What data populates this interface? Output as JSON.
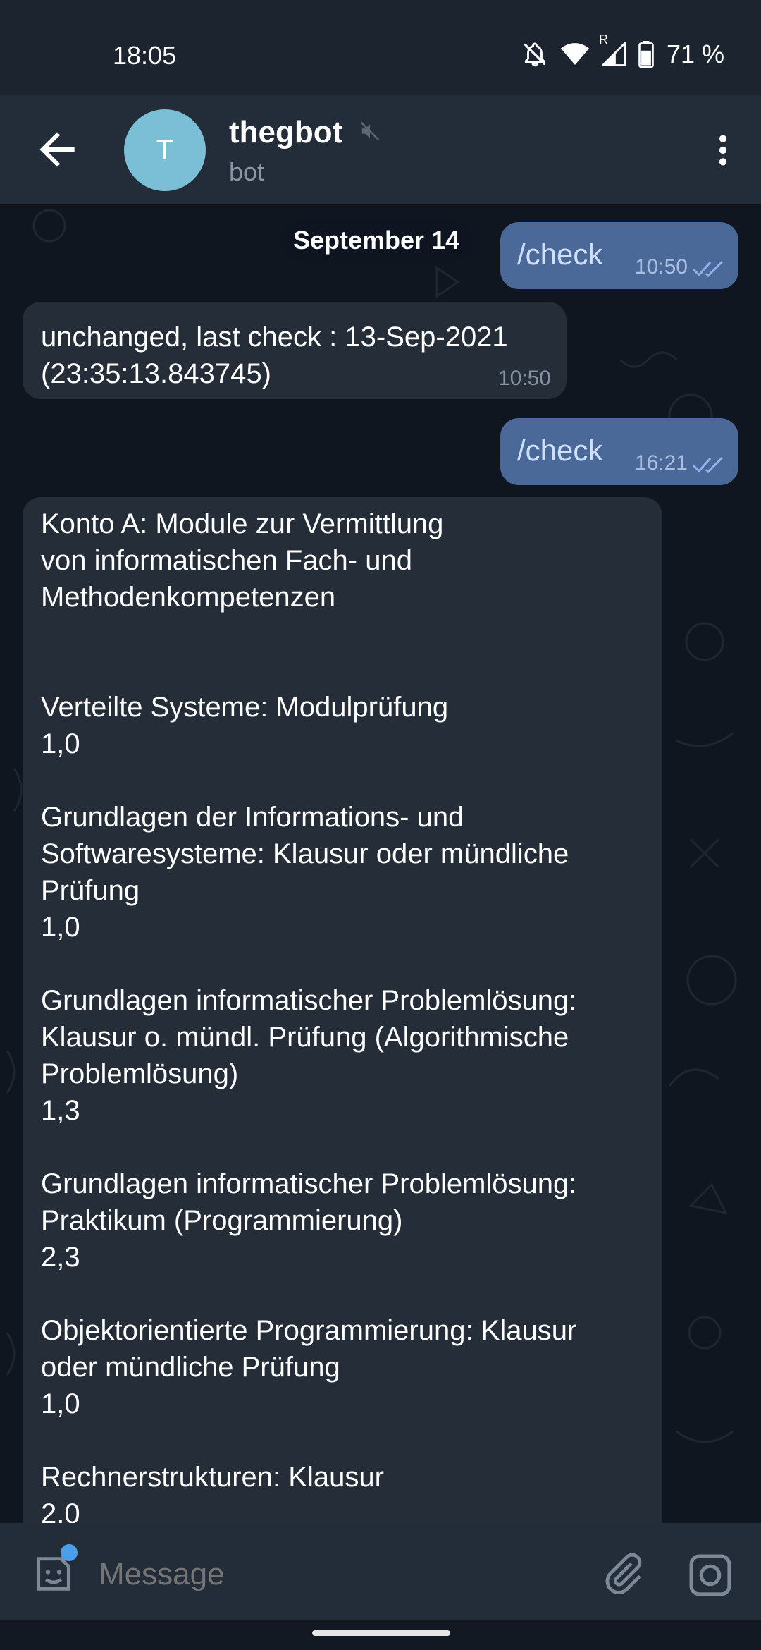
{
  "status_bar": {
    "time": "18:05",
    "battery_label": "71 %",
    "network_indicator": "R"
  },
  "header": {
    "avatar_letter": "T",
    "title": "thegbot",
    "subtitle": "bot"
  },
  "chat": {
    "date_chip": "September 14",
    "messages": [
      {
        "direction": "out",
        "text": "/check",
        "time": "10:50",
        "status": "read"
      },
      {
        "direction": "in",
        "text": "unchanged, last check : 13-Sep-2021\n(23:35:13.843745)",
        "time": "10:50"
      },
      {
        "direction": "out",
        "text": "/check",
        "time": "16:21",
        "status": "read"
      },
      {
        "direction": "in",
        "lines": [
          "Konto A: Module zur Vermittlung",
          "von informatischen Fach- und",
          "Methodenkompetenzen",
          "",
          "",
          "Verteilte Systeme: Modulprüfung",
          "1,0",
          "",
          "Grundlagen der Informations- und",
          "Softwaresysteme:  Klausur oder mündliche",
          "Prüfung",
          "1,0",
          "",
          "Grundlagen informatischer Problemlösung:",
          "Klausur o. mündl. Prüfung (Algorithmische",
          "Problemlösung)",
          "1,3",
          "",
          "Grundlagen informatischer Problemlösung:",
          "Praktikum (Programmierung)",
          "2,3",
          "",
          "Objektorientierte Programmierung: Klausur",
          "oder mündliche Prüfung",
          "1,0",
          "",
          "Rechnerstrukturen: Klausur",
          "2,0"
        ]
      }
    ]
  },
  "input": {
    "placeholder": "Message"
  },
  "colors": {
    "accent": "#4a9fe8",
    "outgoing_bubble": "#4a6898",
    "incoming_bubble": "#252d39",
    "avatar": "#7bbfd6"
  }
}
